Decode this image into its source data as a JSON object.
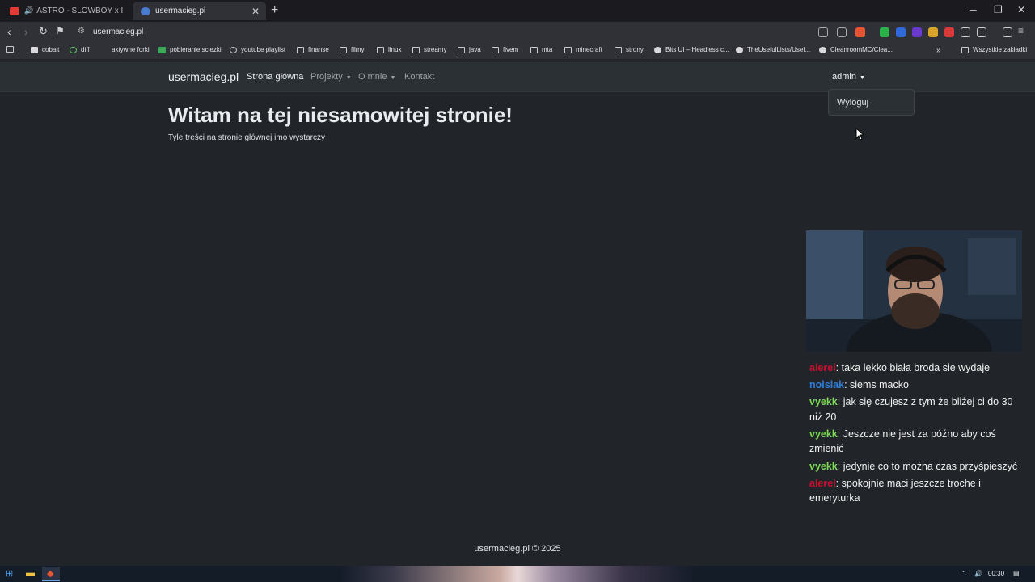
{
  "browser": {
    "tabs": [
      {
        "title": "ASTRO - SLOWBOY x IVOXYGEN"
      },
      {
        "title": "usermacieg.pl"
      }
    ],
    "url": "usermacieg.pl",
    "bookmarks": [
      {
        "label": "cobalt"
      },
      {
        "label": "diff"
      },
      {
        "label": "aktywne forki"
      },
      {
        "label": "pobieranie sciezki"
      },
      {
        "label": "youtube playlist"
      },
      {
        "label": "finanse"
      },
      {
        "label": "filmy"
      },
      {
        "label": "linux"
      },
      {
        "label": "streamy"
      },
      {
        "label": "java"
      },
      {
        "label": "fivem"
      },
      {
        "label": "mta"
      },
      {
        "label": "minecraft"
      },
      {
        "label": "strony"
      },
      {
        "label": "Bits UI – Headless c..."
      },
      {
        "label": "TheUsefulLists/Usef..."
      },
      {
        "label": "CleanroomMC/Clea..."
      }
    ],
    "all_bookmarks": "Wszystkie zakładki"
  },
  "site": {
    "brand": "usermacieg.pl",
    "nav": {
      "home": "Strona główna",
      "projects": "Projekty",
      "about": "O mnie",
      "contact": "Kontakt"
    },
    "user": "admin",
    "dropdown": {
      "logout": "Wyloguj"
    },
    "heading": "Witam na tej niesamowitej stronie!",
    "lead": "Tyle treści na stronie głównej imo wystarczy",
    "footer": "usermacieg.pl © 2025"
  },
  "chat": {
    "messages": [
      {
        "user": "alerel",
        "text": ": taka lekko biała broda sie wydaje",
        "color": "#c8102e"
      },
      {
        "user": "noisiak",
        "text": ": siems macko",
        "color": "#2f7fd8"
      },
      {
        "user": "vyekk",
        "text": ": jak się czujesz z tym że bliżej ci do 30 niż 20",
        "color": "#7ed957"
      },
      {
        "user": "vyekk",
        "text": ": Jeszcze nie jest za późno aby coś zmienić",
        "color": "#7ed957"
      },
      {
        "user": "vyekk",
        "text": ": jedynie co to można czas przyśpieszyć",
        "color": "#7ed957"
      },
      {
        "user": "alerel",
        "text": ": spokojnie maci jeszcze troche i emeryturka",
        "color": "#c8102e"
      }
    ]
  },
  "taskbar": {
    "time": "00:30"
  }
}
